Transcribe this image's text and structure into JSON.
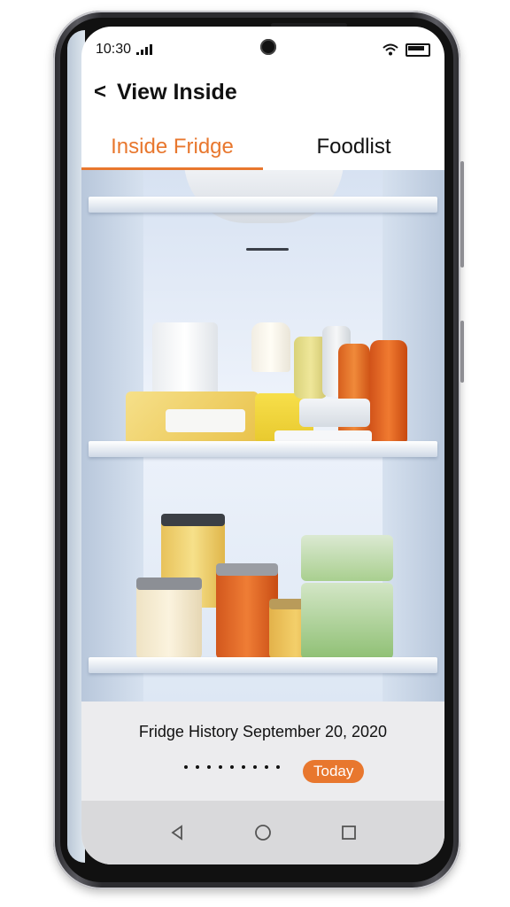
{
  "status_bar": {
    "time": "10:30"
  },
  "header": {
    "title": "View Inside"
  },
  "tabs": [
    {
      "label": "Inside Fridge",
      "active": true
    },
    {
      "label": "Foodlist",
      "active": false
    }
  ],
  "history": {
    "label": "Fridge History September 20, 2020",
    "today_label": "Today",
    "timeline_dot_count": 9
  },
  "colors": {
    "accent": "#e8772e"
  },
  "icons": {
    "back": "back-icon",
    "signal": "signal-icon",
    "wifi": "wifi-icon",
    "battery": "battery-icon",
    "camera": "front-camera-icon",
    "nav_back": "nav-back-icon",
    "nav_home": "nav-home-icon",
    "nav_recents": "nav-recents-icon"
  }
}
